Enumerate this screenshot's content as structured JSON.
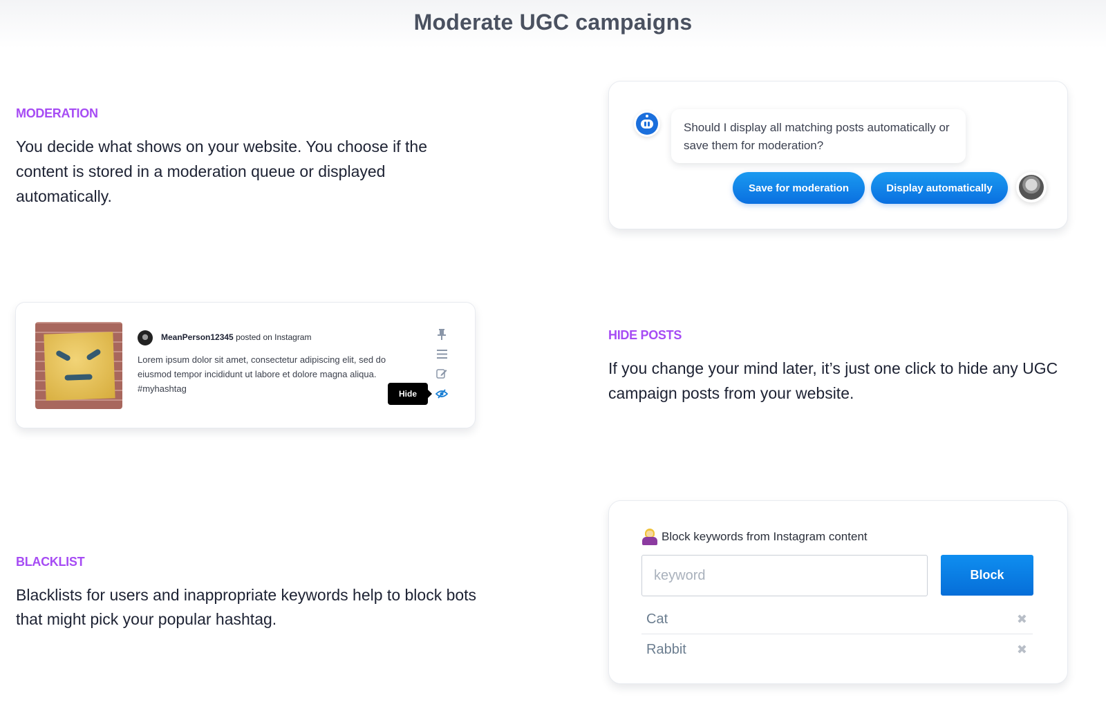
{
  "page": {
    "title": "Moderate UGC campaigns"
  },
  "sections": {
    "moderation": {
      "label": "MODERATION",
      "text": "You decide what shows on your website. You choose if the content is stored in a moderation queue or displayed automatically."
    },
    "hide_posts": {
      "label": "HIDE POSTS",
      "text": "If you change your mind later, it’s just one click to hide any UGC campaign posts from your website."
    },
    "blacklist": {
      "label": "BLACKLIST",
      "text": "Blacklists for users and inappropriate keywords help to block bots that might pick your popular hashtag."
    }
  },
  "chat_card": {
    "bot_icon": "robot-icon",
    "question": "Should I display all matching posts automatically or save them for moderation?",
    "buttons": {
      "save": "Save for moderation",
      "display": "Display automatically"
    },
    "user_avatar": "user-photo"
  },
  "post_card": {
    "image": "angry-face-sign-photo",
    "author": "MeanPerson12345",
    "posted_on": "posted on Instagram",
    "body": "Lorem ipsum dolor sit amet, consectetur adipiscing elit, sed do eiusmod tempor incididunt ut labore et dolore magna aliqua. #myhashtag",
    "actions": {
      "pin_icon": "pin-icon",
      "menu_icon": "menu-icon",
      "edit_icon": "edit-icon",
      "hide_icon": "eye-slash-icon"
    },
    "tooltip": "Hide",
    "accent": "#1a7fd4"
  },
  "blacklist_card": {
    "emoji": "woman-gesturing-no-emoji",
    "title": "Block keywords from Instagram content",
    "input": {
      "value": "",
      "placeholder": "keyword"
    },
    "block_button": "Block",
    "keywords": [
      {
        "label": "Cat"
      },
      {
        "label": "Rabbit"
      }
    ],
    "remove_icon": "✖"
  },
  "colors": {
    "accent_purple": "#a64bf4",
    "primary_blue": "#0a74e0",
    "title_gray": "#4a5160"
  }
}
